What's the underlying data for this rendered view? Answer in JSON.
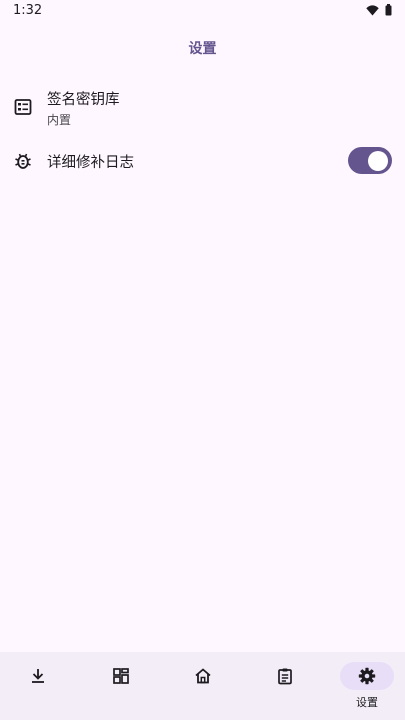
{
  "status_bar": {
    "time": "1:32",
    "icons": [
      "wifi-icon",
      "battery-icon"
    ]
  },
  "header": {
    "title": "设置"
  },
  "settings": {
    "keystore": {
      "title": "签名密钥库",
      "subtitle": "内置",
      "icon": "keystore-list-icon"
    },
    "verbose_log": {
      "title": "详细修补日志",
      "icon": "bug-icon",
      "enabled": true
    }
  },
  "bottom_nav": {
    "items": [
      {
        "icon": "download-icon",
        "label": ""
      },
      {
        "icon": "grid-icon",
        "label": ""
      },
      {
        "icon": "home-icon",
        "label": ""
      },
      {
        "icon": "clipboard-icon",
        "label": ""
      },
      {
        "icon": "settings-gear-icon",
        "label": "设置"
      }
    ],
    "active_index": 4
  },
  "colors": {
    "accent": "#65558f",
    "background": "#fef7ff",
    "nav_background": "#f3edf7",
    "active_indicator": "#e8def8"
  }
}
